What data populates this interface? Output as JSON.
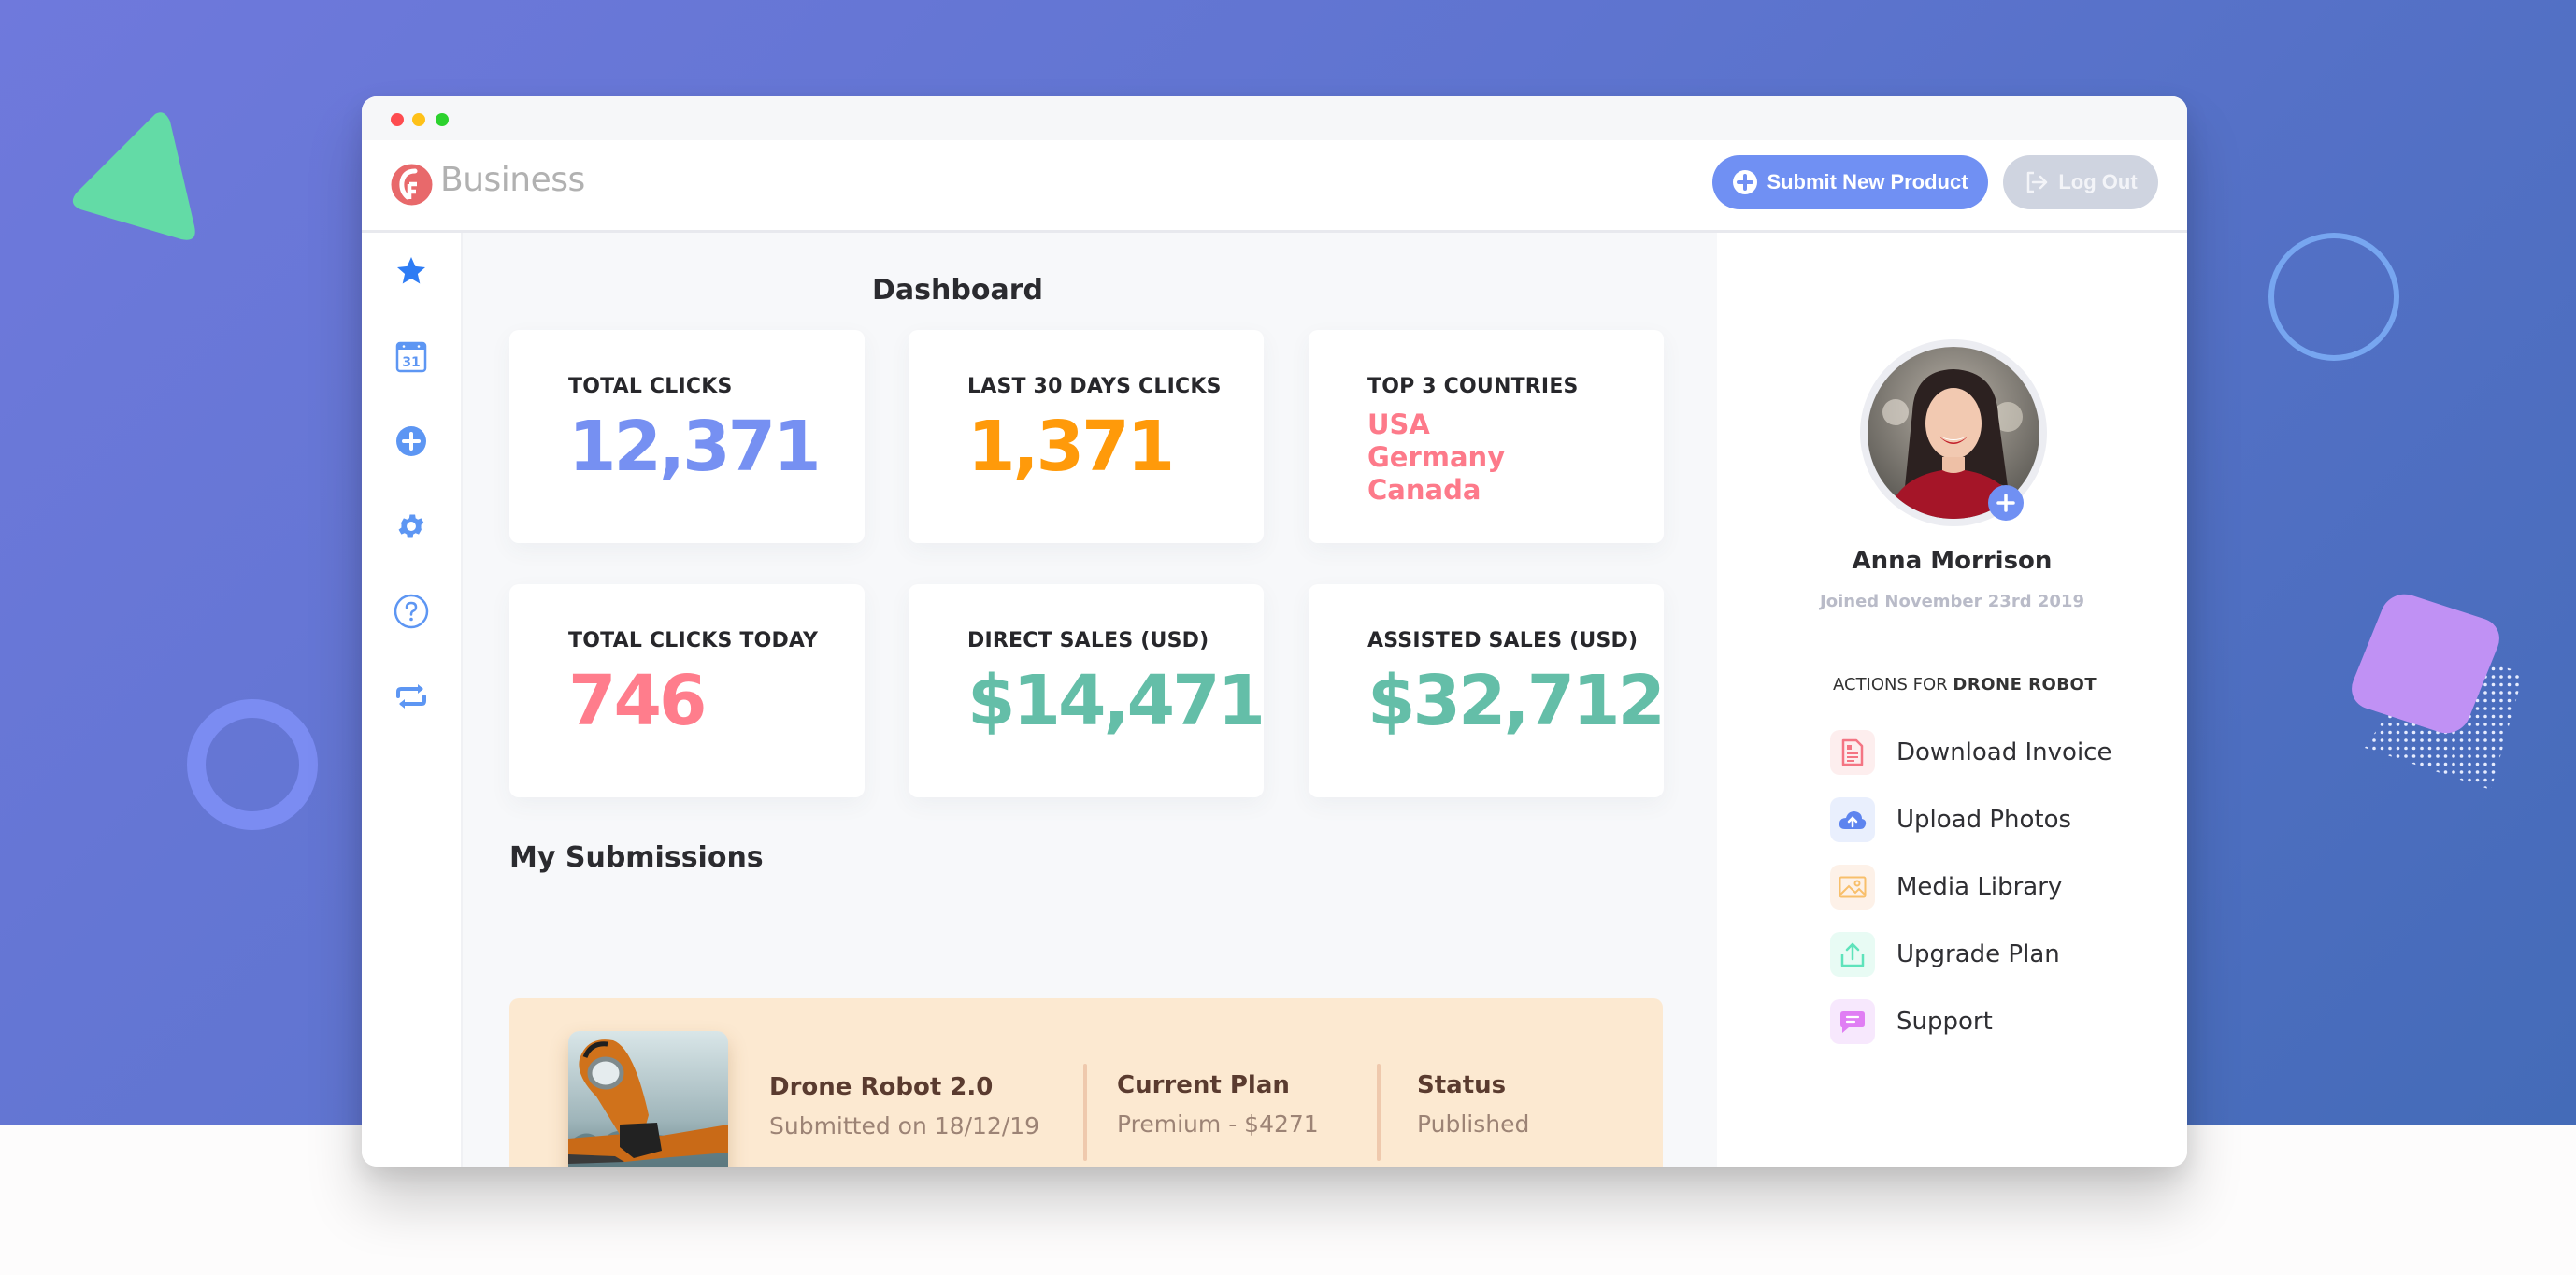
{
  "window": {
    "brand": "Business"
  },
  "header": {
    "submit_label": "Submit New Product",
    "logout_label": "Log Out"
  },
  "sidebar": {
    "items": [
      {
        "icon": "star-icon",
        "active": true
      },
      {
        "icon": "calendar-icon",
        "text": "31"
      },
      {
        "icon": "plus-circle-icon"
      },
      {
        "icon": "gear-icon"
      },
      {
        "icon": "help-circle-icon"
      },
      {
        "icon": "repeat-icon"
      }
    ]
  },
  "dashboard": {
    "title": "Dashboard",
    "cards": [
      {
        "label": "TOTAL CLICKS",
        "value": "12,371",
        "color": "#7690f2"
      },
      {
        "label": "LAST 30 DAYS CLICKS",
        "value": "1,371",
        "color": "#ff9a0a"
      },
      {
        "label": "TOP 3 COUNTRIES",
        "countries": [
          "USA",
          "Germany",
          "Canada"
        ],
        "color": "#fd7a8a"
      },
      {
        "label": "TOTAL CLICKS TODAY",
        "value": "746",
        "color": "#ff7d8c"
      },
      {
        "label": "DIRECT SALES (USD)",
        "value": "$14,471",
        "color": "#64bea8"
      },
      {
        "label": "ASSISTED SALES (USD)",
        "value": "$32,712",
        "color": "#64bea8"
      }
    ]
  },
  "submissions": {
    "title": "My Submissions",
    "item": {
      "name": "Drone Robot 2.0",
      "submitted": "Submitted on 18/12/19",
      "plan_label": "Current Plan",
      "plan_value": "Premium - $4271",
      "status_label": "Status",
      "status_value": "Published"
    }
  },
  "profile": {
    "name": "Anna Morrison",
    "joined": "Joined November 23rd 2019",
    "actions_prefix": "ACTIONS FOR ",
    "actions_product": "DRONE ROBOT",
    "actions": [
      {
        "label": "Download Invoice",
        "icon": "invoice-icon",
        "bg": "#fdeeee",
        "color": "#f47583"
      },
      {
        "label": "Upload Photos",
        "icon": "cloud-upload-icon",
        "bg": "#e9effd",
        "color": "#5d84ef"
      },
      {
        "label": "Media Library",
        "icon": "image-icon",
        "bg": "#fdf1e8",
        "color": "#f8bf6b"
      },
      {
        "label": "Upgrade Plan",
        "icon": "share-upload-icon",
        "bg": "#e8fbf4",
        "color": "#5ee3bb"
      },
      {
        "label": "Support",
        "icon": "chat-icon",
        "bg": "#f7e8fd",
        "color": "#e07ef4"
      }
    ]
  }
}
